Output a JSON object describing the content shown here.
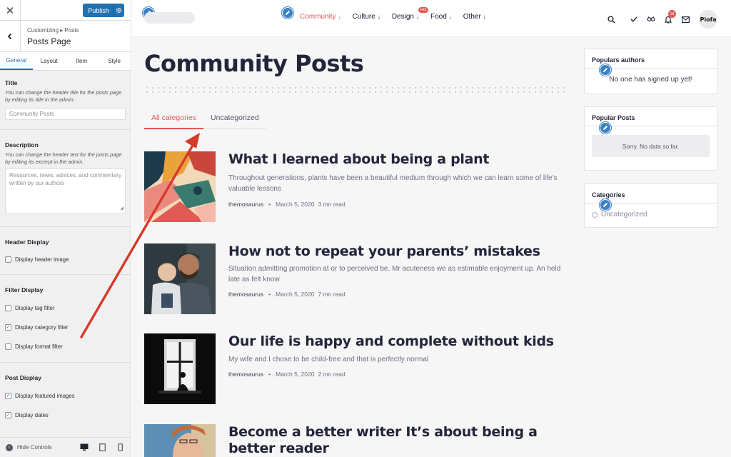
{
  "customizer": {
    "publish_label": "Publish",
    "breadcrumb": "Customizing ▸ Posts",
    "panel_title": "Posts Page",
    "tabs": [
      "General",
      "Layout",
      "Item",
      "Style"
    ],
    "title_section": {
      "heading": "Title",
      "description": "You can change the header title for the posts page by editing its title in the admin.",
      "input_value": "Community Posts"
    },
    "description_section": {
      "heading": "Description",
      "description": "You can change the header text for the posts page by editing its excerpt in the admin.",
      "textarea_placeholder": "Resources, news, advices, and commentary written by our authors"
    },
    "header_display": {
      "heading": "Header Display",
      "option": "Display header image",
      "checked": false
    },
    "filter_display": {
      "heading": "Filter Display",
      "options": [
        {
          "label": "Display tag filter",
          "checked": false
        },
        {
          "label": "Display category filter",
          "checked": true
        },
        {
          "label": "Display format filter",
          "checked": false
        }
      ]
    },
    "post_display": {
      "heading": "Post Display",
      "options": [
        {
          "label": "Display featured images",
          "checked": true
        },
        {
          "label": "Display dates",
          "checked": true
        }
      ]
    },
    "hide_controls": "Hide Controls"
  },
  "preview": {
    "nav": [
      {
        "label": "Community",
        "active": true
      },
      {
        "label": "Culture"
      },
      {
        "label": "Design",
        "badge": "Hot"
      },
      {
        "label": "Food"
      },
      {
        "label": "Other"
      }
    ],
    "notification_count": "18",
    "avatar_text": "Piofa",
    "page_title": "Community Posts",
    "filters": [
      "All categories",
      "Uncategorized"
    ],
    "posts": [
      {
        "title": "What I learned about being a plant",
        "excerpt": "Throughout generations, plants have been a beautiful medium through which we can learn some of life's valuable lessons",
        "author": "themosaurus",
        "date": "March 5, 2020",
        "read": "3 mn read"
      },
      {
        "title": "How not to repeat your parents’ mistakes",
        "excerpt": "Situation admitting promotion at or to perceived be. Mr acuteness we as estimable enjoyment up. An held late as felt know",
        "author": "themosaurus",
        "date": "March 5, 2020",
        "read": "7 mn read"
      },
      {
        "title": "Our life is happy and complete without kids",
        "excerpt": "My wife and I chose to be child-free and that is perfectly normal",
        "author": "themosaurus",
        "date": "March 5, 2020",
        "read": "2 mn read"
      },
      {
        "title": "Become a better writer It’s about being a better reader"
      }
    ],
    "widgets": {
      "authors": {
        "title": "Populars authors",
        "empty": "No one has signed up yet!"
      },
      "popular_posts": {
        "title": "Popular Posts",
        "empty": "Sorry. No data so far."
      },
      "categories": {
        "title": "Categories",
        "item": "Uncategorized"
      }
    }
  },
  "colors": {
    "wp_blue": "#2271b1",
    "accent_red": "#e05a56",
    "annotation_arrow": "#d63a2a",
    "title_dark": "#23263a"
  }
}
